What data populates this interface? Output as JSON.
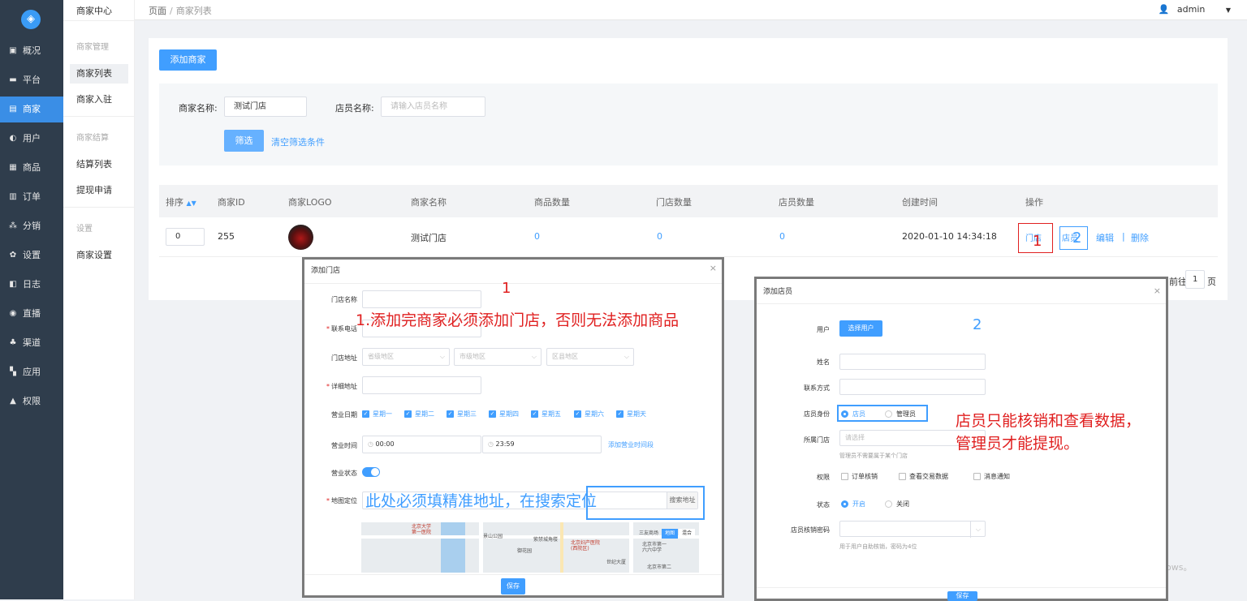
{
  "sidebar": {
    "items": [
      {
        "label": "概况",
        "icon": "monitor-icon"
      },
      {
        "label": "平台",
        "icon": "screen-icon"
      },
      {
        "label": "商家",
        "icon": "store-icon"
      },
      {
        "label": "用户",
        "icon": "user-icon"
      },
      {
        "label": "商品",
        "icon": "goods-icon"
      },
      {
        "label": "订单",
        "icon": "order-icon"
      },
      {
        "label": "分销",
        "icon": "share-icon"
      },
      {
        "label": "设置",
        "icon": "gear-icon"
      },
      {
        "label": "日志",
        "icon": "log-icon"
      },
      {
        "label": "直播",
        "icon": "live-icon"
      },
      {
        "label": "渠道",
        "icon": "channel-icon"
      },
      {
        "label": "应用",
        "icon": "apps-icon"
      },
      {
        "label": "权限",
        "icon": "lock-icon"
      }
    ],
    "active": "商家"
  },
  "submenu": {
    "title": "商家中心",
    "group1": "商家管理",
    "item_list": "商家列表",
    "item_join": "商家入驻",
    "group2": "商家结算",
    "item_settle": "结算列表",
    "item_withdraw": "提现申请",
    "group3": "设置",
    "item_settings": "商家设置"
  },
  "topbar": {
    "crumb_root": "页面",
    "crumb_sep": "/",
    "crumb_current": "商家列表",
    "user": "admin"
  },
  "toolbar": {
    "add_button": "添加商家"
  },
  "filter": {
    "name_label": "商家名称:",
    "name_value": "测试门店",
    "clerk_label": "店员名称:",
    "clerk_placeholder": "请输入店员名称",
    "filter_button": "筛选",
    "clear_link": "清空筛选条件"
  },
  "table": {
    "headers": [
      "排序",
      "商家ID",
      "商家LOGO",
      "商家名称",
      "商品数量",
      "门店数量",
      "店员数量",
      "创建时间",
      "操作"
    ],
    "row": {
      "sort": "0",
      "id": "255",
      "name": "测试门店",
      "goods": "0",
      "stores": "0",
      "clerks": "0",
      "created": "2020-01-10 14:34:18",
      "op_store": "门店",
      "op_clerk": "店员",
      "op_edit": "编辑",
      "op_sep": "|",
      "op_delete": "删除"
    }
  },
  "pagination": {
    "goto": "前往",
    "page": "1",
    "unit": "页"
  },
  "annotations": {
    "num1": "1",
    "num2": "2",
    "note1": "1.添加完商家必须添加门店，否则无法添加商品",
    "note_map": "此处必须填精准地址，在搜索定位",
    "note2_line1": "店员只能核销和查看数据，",
    "note2_line2": "管理员才能提现。"
  },
  "store_dialog": {
    "title": "添加门店",
    "close": "×",
    "name_label": "门店名称",
    "phone_label": "联系电话",
    "addr_label": "门店地址",
    "province_ph": "省级地区",
    "city_ph": "市级地区",
    "district_ph": "区县地区",
    "detail_label": "详细地址",
    "days_label": "营业日期",
    "days": [
      "星期一",
      "星期二",
      "星期三",
      "星期四",
      "星期五",
      "星期六",
      "星期天"
    ],
    "time_label": "营业时间",
    "time_start": "00:00",
    "time_end": "23:59",
    "add_time_link": "添加营业时间段",
    "status_label": "营业状态",
    "map_label": "地图定位",
    "search_button": "搜索地址",
    "map_labels": [
      "北京大学",
      "第一医院",
      "景山公园",
      "紫禁城角楼",
      "北京妇产医院",
      "(西院区)",
      "御花园",
      "三友商场",
      "北京市第一",
      "六六中学",
      "世纪大厦",
      "北京市第二"
    ],
    "map_toggle_1": "地图",
    "map_toggle_2": "混合",
    "save_button": "保存"
  },
  "clerk_dialog": {
    "title": "添加店员",
    "close": "×",
    "user_label": "用户",
    "select_user_button": "选择用户",
    "name_label": "姓名",
    "contact_label": "联系方式",
    "role_label": "店员身份",
    "role_clerk": "店员",
    "role_admin": "管理员",
    "store_label": "所属门店",
    "store_ph": "请选择",
    "store_hint": "管理员不需要属于某个门店",
    "perm_label": "权限",
    "perm_verify": "订单核销",
    "perm_trade": "查看交易数据",
    "perm_msg": "消息通知",
    "state_label": "状态",
    "state_on": "开启",
    "state_off": "关闭",
    "pwd_label": "店员核销密码",
    "pwd_hint": "用于用户自助核销，密码为4位",
    "save_button": "保存"
  },
  "watermark": "ows。",
  "colors": {
    "primary": "#409eff",
    "sidebar": "#2f3d4c",
    "annotation_red": "#e02020"
  }
}
